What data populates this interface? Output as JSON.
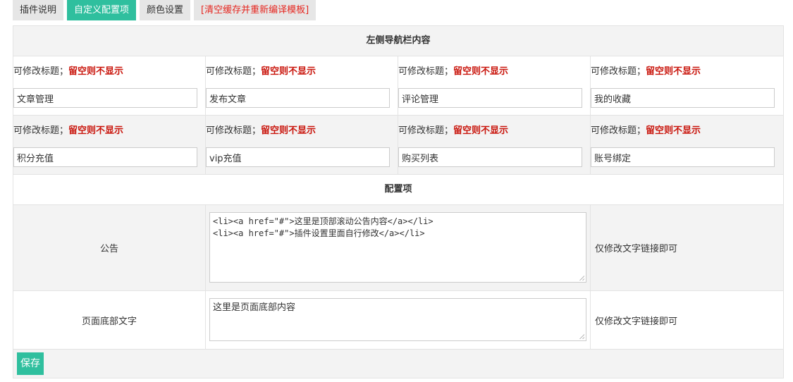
{
  "tabs": [
    {
      "label": "插件说明"
    },
    {
      "label": "自定义配置项"
    },
    {
      "label": "颜色设置"
    },
    {
      "label": "[清空缓存并重新编译模板]"
    }
  ],
  "colors": {
    "accent": "#2fbf9e",
    "hint_red": "#c9140b",
    "warn_red": "#e5261f",
    "row_gray": "#f3f3f3"
  },
  "nav_section": {
    "title": "左侧导航栏内容",
    "label_prefix": "可修改标题；",
    "label_hint": "留空则不显示",
    "items": [
      {
        "value": "文章管理"
      },
      {
        "value": "发布文章"
      },
      {
        "value": "评论管理"
      },
      {
        "value": "我的收藏"
      },
      {
        "value": "积分充值"
      },
      {
        "value": "vip充值"
      },
      {
        "value": "购买列表"
      },
      {
        "value": "账号绑定"
      }
    ]
  },
  "config_section": {
    "title": "配置项",
    "notice": {
      "label": "公告",
      "value": "<li><a href=\"#\">这里是顶部滚动公告内容</a></li>\n<li><a href=\"#\">插件设置里面自行修改</a></li>",
      "note": "仅修改文字链接即可"
    },
    "footer": {
      "label": "页面底部文字",
      "value": "这里是页面底部内容",
      "note": "仅修改文字链接即可"
    }
  },
  "save_label": "保存"
}
